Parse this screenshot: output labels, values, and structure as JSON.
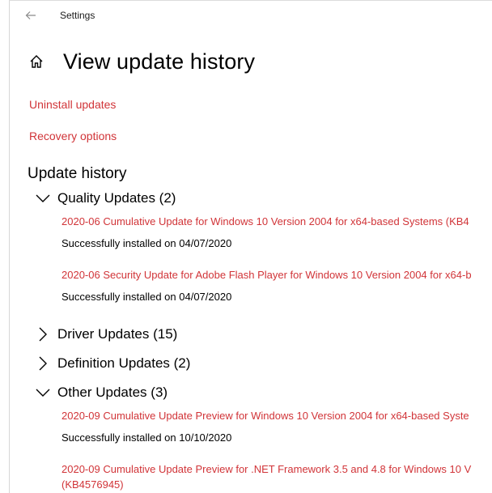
{
  "window": {
    "title": "Settings",
    "back_icon": "back-arrow-icon"
  },
  "page": {
    "title": "View update history",
    "home_icon": "home-icon"
  },
  "links": {
    "uninstall": "Uninstall updates",
    "recovery": "Recovery options"
  },
  "history": {
    "title": "Update history",
    "categories": {
      "quality": {
        "label": "Quality Updates (2)",
        "expanded": true,
        "items": [
          {
            "name": "2020-06 Cumulative Update for Windows 10 Version 2004 for x64-based Systems (KB4",
            "status": "Successfully installed on 04/07/2020"
          },
          {
            "name": "2020-06 Security Update for Adobe Flash Player for Windows 10 Version 2004 for x64-b",
            "status": "Successfully installed on 04/07/2020"
          }
        ]
      },
      "driver": {
        "label": "Driver Updates (15)",
        "expanded": false
      },
      "definition": {
        "label": "Definition Updates (2)",
        "expanded": false
      },
      "other": {
        "label": "Other Updates (3)",
        "expanded": true,
        "items": [
          {
            "name": "2020-09 Cumulative Update Preview for Windows 10 Version 2004 for x64-based Syste",
            "status": "Successfully installed on 10/10/2020"
          },
          {
            "name": "2020-09 Cumulative Update Preview for .NET Framework 3.5 and 4.8 for Windows 10 V",
            "name_line2": "(KB4576945)"
          }
        ]
      }
    }
  },
  "colors": {
    "link": "#d13438",
    "text": "#000000",
    "background": "#ffffff"
  }
}
